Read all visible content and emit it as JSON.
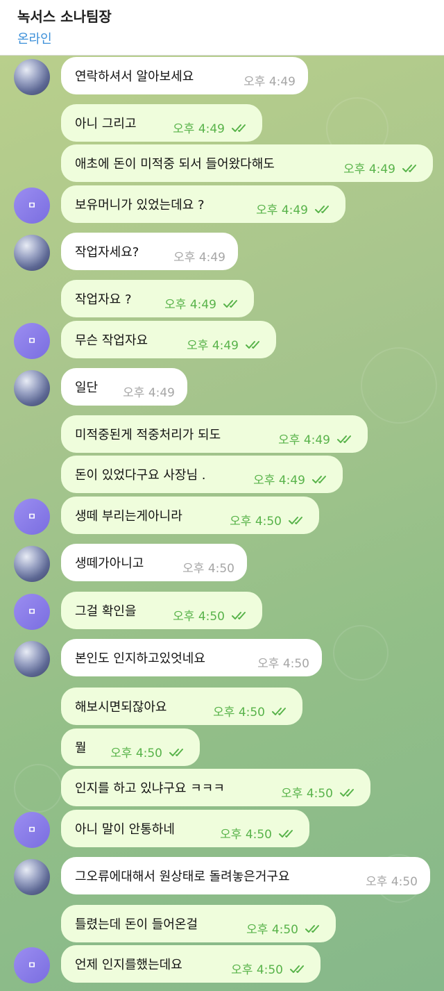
{
  "header": {
    "title": "녹서스 소나팀장",
    "status": "온라인"
  },
  "colors": {
    "incoming_bubble": "#ffffff",
    "outgoing_bubble": "#effddc",
    "read_check": "#58b34a",
    "status_online": "#3b8fd9",
    "avatar_purple": "#8b7fe9"
  },
  "messages": [
    {
      "dir": "in",
      "avatar": "photo",
      "text": "연락하셔서 알아보세요",
      "time": "오후 4:49"
    },
    {
      "dir": "out",
      "avatar": "",
      "text": "아니 그리고",
      "time": "오후 4:49"
    },
    {
      "dir": "out",
      "avatar": "",
      "text": "애초에 돈이 미적중 되서 들어왔다해도",
      "time": "오후 4:49"
    },
    {
      "dir": "out",
      "avatar": "letter",
      "text": "보유머니가 있었는데요 ?",
      "time": "오후 4:49"
    },
    {
      "dir": "in",
      "avatar": "photo",
      "text": "작업자세요?",
      "time": "오후 4:49"
    },
    {
      "dir": "out",
      "avatar": "",
      "text": "작업자요 ?",
      "time": "오후 4:49"
    },
    {
      "dir": "out",
      "avatar": "letter",
      "text": "무슨 작업자요",
      "time": "오후 4:49"
    },
    {
      "dir": "in",
      "avatar": "photo",
      "text": "일단",
      "time": "오후 4:49"
    },
    {
      "dir": "out",
      "avatar": "",
      "text": "미적중된게 적중처리가 되도",
      "time": "오후 4:49"
    },
    {
      "dir": "out",
      "avatar": "",
      "text": "돈이 있었다구요 사장님 .",
      "time": "오후 4:49"
    },
    {
      "dir": "out",
      "avatar": "letter",
      "text": "생떼 부리는게아니라",
      "time": "오후 4:50"
    },
    {
      "dir": "in",
      "avatar": "photo",
      "text": "생떼가아니고",
      "time": "오후 4:50"
    },
    {
      "dir": "out",
      "avatar": "letter",
      "text": "그걸 확인을",
      "time": "오후 4:50"
    },
    {
      "dir": "in",
      "avatar": "photo",
      "text": "본인도 인지하고있엇네요",
      "time": "오후 4:50"
    },
    {
      "dir": "out",
      "avatar": "",
      "text": "해보시면되잖아요",
      "time": "오후 4:50"
    },
    {
      "dir": "out",
      "avatar": "",
      "text": "뭘",
      "time": "오후 4:50"
    },
    {
      "dir": "out",
      "avatar": "",
      "text": "인지를 하고 있냐구요 ㅋㅋㅋ",
      "time": "오후 4:50"
    },
    {
      "dir": "out",
      "avatar": "letter",
      "text": "아니 말이 안통하네",
      "time": "오후 4:50"
    },
    {
      "dir": "in",
      "avatar": "photo",
      "text": "그오류에대해서 원상태로 돌려놓은거구요",
      "time": "오후 4:50"
    },
    {
      "dir": "out",
      "avatar": "",
      "text": "틀렸는데 돈이 들어온걸",
      "time": "오후 4:50"
    },
    {
      "dir": "out",
      "avatar": "letter",
      "text": "언제 인지를했는데요",
      "time": "오후 4:50"
    }
  ],
  "avatar_letter": "ㅁ"
}
